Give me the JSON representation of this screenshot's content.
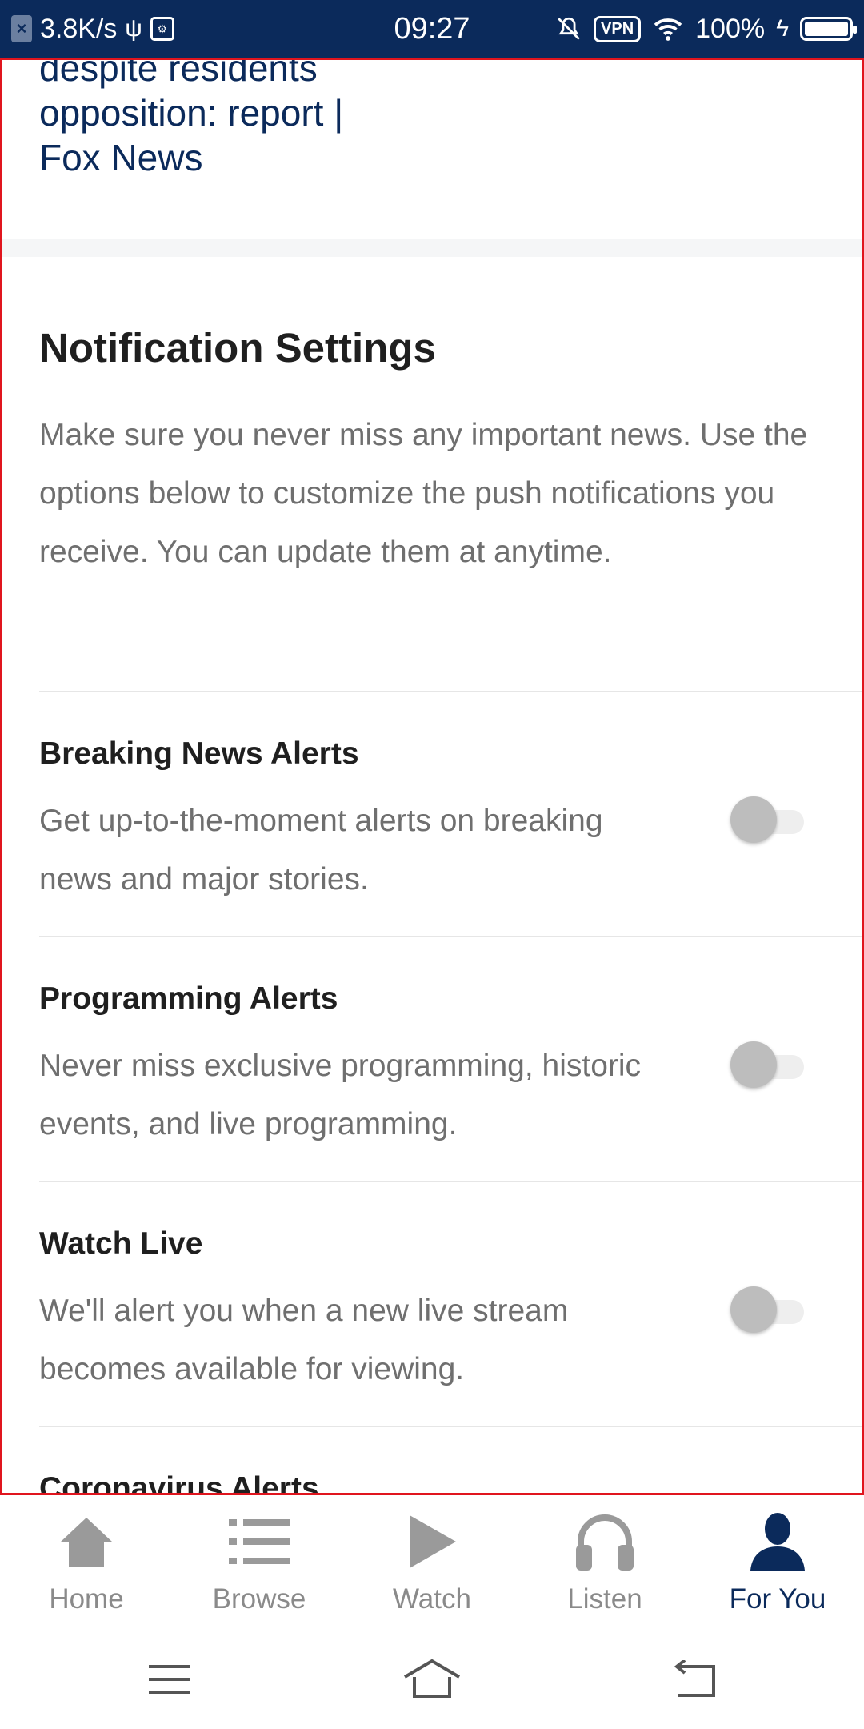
{
  "status_bar": {
    "net_speed": "3.8K/s",
    "time": "09:27",
    "vpn": "VPN",
    "battery": "100%"
  },
  "article": {
    "title_lines": [
      "despite residents",
      "opposition: report |",
      "Fox News"
    ]
  },
  "notifications": {
    "title": "Notification Settings",
    "intro": "Make sure you never miss any important news. Use the options below to customize the push notifications you receive. You can update them at anytime.",
    "items": [
      {
        "label": "Breaking News Alerts",
        "desc": "Get up-to-the-moment alerts on breaking news and major stories.",
        "enabled": false
      },
      {
        "label": "Programming Alerts",
        "desc": "Never miss exclusive programming, historic events, and live programming.",
        "enabled": false
      },
      {
        "label": "Watch Live",
        "desc": "We'll alert you when a new live stream becomes available for viewing.",
        "enabled": false
      },
      {
        "label": "Coronavirus Alerts"
      }
    ]
  },
  "tabbar": {
    "items": [
      {
        "label": "Home",
        "icon": "home-icon"
      },
      {
        "label": "Browse",
        "icon": "list-icon"
      },
      {
        "label": "Watch",
        "icon": "play-icon"
      },
      {
        "label": "Listen",
        "icon": "headphones-icon"
      },
      {
        "label": "For You",
        "icon": "person-icon",
        "active": true
      }
    ]
  },
  "colors": {
    "brand": "#0b2a5b",
    "inactive": "#8a8a8a",
    "frame": "#e0151e"
  }
}
